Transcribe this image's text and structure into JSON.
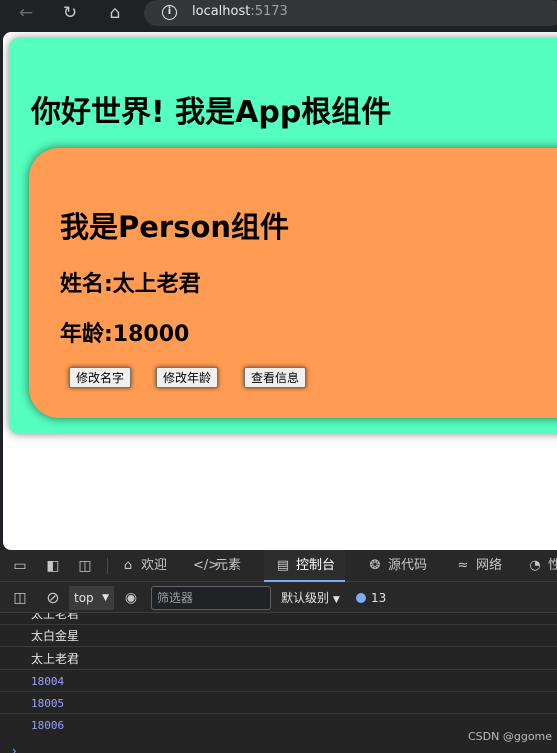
{
  "browser": {
    "url_host": "localhost",
    "url_port": ":5173"
  },
  "app": {
    "title": "你好世界! 我是App根组件",
    "background": "#54ffbf",
    "person": {
      "title": "我是Person组件",
      "name_line": "姓名:太上老君",
      "age_line": "年龄:18000",
      "background": "#ff9b53",
      "buttons": {
        "change_name": "修改名字",
        "change_age": "修改年龄",
        "view_info": "查看信息"
      }
    }
  },
  "devtools": {
    "tabs": {
      "welcome": "欢迎",
      "elements": "元素",
      "console": "控制台",
      "sources": "源代码",
      "network": "网络",
      "performance": "性"
    },
    "console_bar": {
      "context": "top",
      "filter_placeholder": "筛选器",
      "levels": "默认级别",
      "issues_count": "13"
    },
    "logs": [
      "太上老君",
      "太白金星",
      "太上老君",
      "18004",
      "18005",
      "18006"
    ],
    "watermark": "CSDN @ggome"
  }
}
